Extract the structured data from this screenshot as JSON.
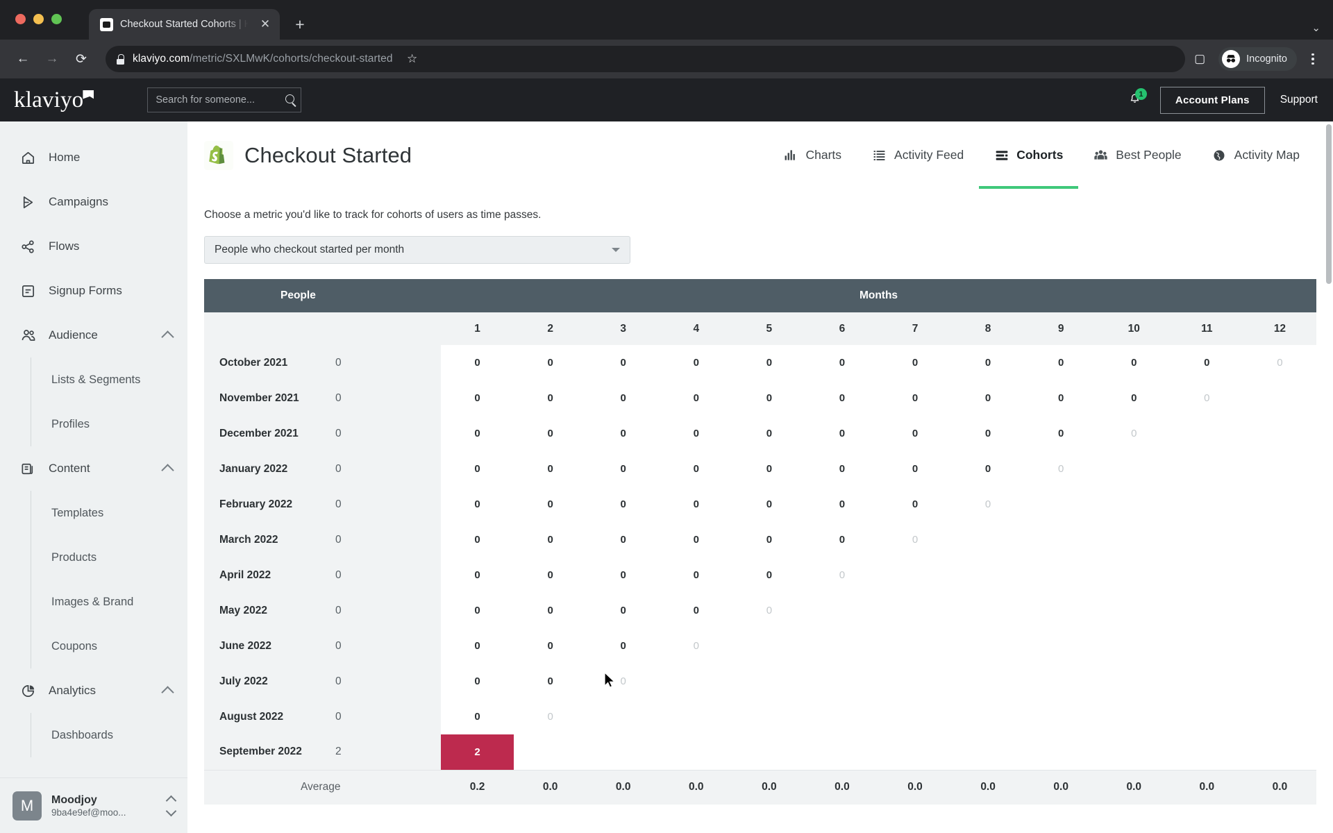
{
  "browser": {
    "tab_title": "Checkout Started Cohorts | Kla",
    "tab_close_glyph": "✕",
    "new_tab_glyph": "+",
    "tabstrip_menu_glyph": "⌄",
    "back_glyph": "←",
    "forward_glyph": "→",
    "reload_glyph": "⟳",
    "url_host": "klaviyo.com",
    "url_path": "/metric/SXLMwK/cohorts/checkout-started",
    "bookmark_glyph": "☆",
    "sidepanel_glyph": "▢",
    "profile_label": "Incognito"
  },
  "topbar": {
    "logo_text": "klaviyo",
    "search_placeholder": "Search for someone...",
    "search_value": "",
    "notification_count": "1",
    "account_plans_label": "Account Plans",
    "support_label": "Support"
  },
  "sidebar": {
    "items": [
      {
        "label": "Home",
        "icon": "home-icon",
        "expandable": false
      },
      {
        "label": "Campaigns",
        "icon": "campaigns-icon",
        "expandable": false
      },
      {
        "label": "Flows",
        "icon": "flows-icon",
        "expandable": false
      },
      {
        "label": "Signup Forms",
        "icon": "signup-forms-icon",
        "expandable": false
      },
      {
        "label": "Audience",
        "icon": "audience-icon",
        "expandable": true,
        "children": [
          "Lists & Segments",
          "Profiles"
        ]
      },
      {
        "label": "Content",
        "icon": "content-icon",
        "expandable": true,
        "children": [
          "Templates",
          "Products",
          "Images & Brand",
          "Coupons"
        ]
      },
      {
        "label": "Analytics",
        "icon": "analytics-icon",
        "expandable": true,
        "children": [
          "Dashboards"
        ]
      }
    ],
    "account": {
      "initial": "M",
      "name": "Moodjoy",
      "email": "9ba4e9ef@moo..."
    }
  },
  "page": {
    "title": "Checkout Started",
    "title_icon": "shopify-icon",
    "tabs": [
      {
        "label": "Charts",
        "icon": "bar-chart-icon",
        "active": false
      },
      {
        "label": "Activity Feed",
        "icon": "list-icon",
        "active": false
      },
      {
        "label": "Cohorts",
        "icon": "cohorts-icon",
        "active": true
      },
      {
        "label": "Best People",
        "icon": "people-icon",
        "active": false
      },
      {
        "label": "Activity Map",
        "icon": "globe-icon",
        "active": false
      }
    ],
    "helper_text": "Choose a metric you'd like to track for cohorts of users as time passes.",
    "metric_select_value": "People who checkout started per month",
    "accent_active_tab": "#3fc87a",
    "highlight_color": "#bd2a4e"
  },
  "chart_data": {
    "type": "heatmap",
    "title": "People who checkout started per month",
    "xlabel": "Months",
    "ylabel": "People",
    "group_headers": [
      "People",
      "Months"
    ],
    "column_headers": [
      "1",
      "2",
      "3",
      "4",
      "5",
      "6",
      "7",
      "8",
      "9",
      "10",
      "11",
      "12"
    ],
    "rows": [
      {
        "label": "October 2021",
        "people": "0",
        "values": [
          "0",
          "0",
          "0",
          "0",
          "0",
          "0",
          "0",
          "0",
          "0",
          "0",
          "0",
          "0"
        ],
        "faded_from": 11
      },
      {
        "label": "November 2021",
        "people": "0",
        "values": [
          "0",
          "0",
          "0",
          "0",
          "0",
          "0",
          "0",
          "0",
          "0",
          "0",
          "0",
          ""
        ],
        "faded_from": 10
      },
      {
        "label": "December 2021",
        "people": "0",
        "values": [
          "0",
          "0",
          "0",
          "0",
          "0",
          "0",
          "0",
          "0",
          "0",
          "0",
          "",
          ""
        ],
        "faded_from": 9
      },
      {
        "label": "January 2022",
        "people": "0",
        "values": [
          "0",
          "0",
          "0",
          "0",
          "0",
          "0",
          "0",
          "0",
          "0",
          "",
          "",
          ""
        ],
        "faded_from": 8
      },
      {
        "label": "February 2022",
        "people": "0",
        "values": [
          "0",
          "0",
          "0",
          "0",
          "0",
          "0",
          "0",
          "0",
          "",
          "",
          "",
          ""
        ],
        "faded_from": 7
      },
      {
        "label": "March 2022",
        "people": "0",
        "values": [
          "0",
          "0",
          "0",
          "0",
          "0",
          "0",
          "0",
          "",
          "",
          "",
          "",
          ""
        ],
        "faded_from": 6
      },
      {
        "label": "April 2022",
        "people": "0",
        "values": [
          "0",
          "0",
          "0",
          "0",
          "0",
          "0",
          "",
          "",
          "",
          "",
          "",
          ""
        ],
        "faded_from": 5
      },
      {
        "label": "May 2022",
        "people": "0",
        "values": [
          "0",
          "0",
          "0",
          "0",
          "0",
          "",
          "",
          "",
          "",
          "",
          "",
          ""
        ],
        "faded_from": 4
      },
      {
        "label": "June 2022",
        "people": "0",
        "values": [
          "0",
          "0",
          "0",
          "0",
          "",
          "",
          "",
          "",
          "",
          "",
          "",
          ""
        ],
        "faded_from": 3
      },
      {
        "label": "July 2022",
        "people": "0",
        "values": [
          "0",
          "0",
          "0",
          "",
          "",
          "",
          "",
          "",
          "",
          "",
          "",
          ""
        ],
        "faded_from": 2
      },
      {
        "label": "August 2022",
        "people": "0",
        "values": [
          "0",
          "0",
          "",
          "",
          "",
          "",
          "",
          "",
          "",
          "",
          "",
          ""
        ],
        "faded_from": 1
      },
      {
        "label": "September 2022",
        "people": "2",
        "values": [
          "2",
          "",
          "",
          "",
          "",
          "",
          "",
          "",
          "",
          "",
          "",
          ""
        ],
        "faded_from": 99,
        "highlight_index": 0
      }
    ],
    "average_label": "Average",
    "averages": [
      "0.2",
      "0.0",
      "0.0",
      "0.0",
      "0.0",
      "0.0",
      "0.0",
      "0.0",
      "0.0",
      "0.0",
      "0.0",
      "0.0"
    ]
  }
}
